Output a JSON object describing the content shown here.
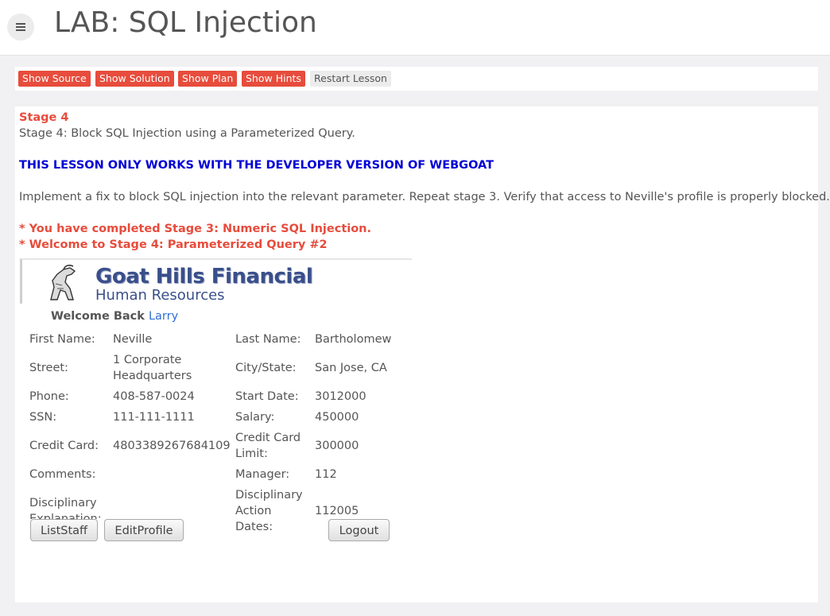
{
  "header": {
    "title": "LAB: SQL Injection",
    "menu_icon": "hamburger-menu-icon"
  },
  "toolbar": {
    "buttons": [
      "Show Source",
      "Show Solution",
      "Show Plan",
      "Show Hints",
      "Restart Lesson"
    ]
  },
  "lesson": {
    "stage_heading": "Stage 4",
    "stage_desc": "Stage 4: Block SQL Injection using a Parameterized Query.",
    "dev_notice": "THIS LESSON ONLY WORKS WITH THE DEVELOPER VERSION OF WEBGOAT",
    "instructions": "Implement a fix to block SQL injection into the relevant parameter. Repeat stage 3. Verify that access to Neville's profile is properly blocked.",
    "msg1": "* You have completed Stage 3: Numeric SQL Injection.",
    "msg2": "* Welcome to Stage 4: Parameterized Query #2"
  },
  "banner": {
    "brand_line1": "Goat Hills Financial",
    "brand_line2": "Human Resources"
  },
  "profile": {
    "welcome": "Welcome Back",
    "user": "Larry",
    "first_name_label": "First Name:",
    "first_name": "Neville",
    "last_name_label": "Last Name:",
    "last_name": "Bartholomew",
    "street_label": "Street:",
    "street_1": "1 Corporate",
    "street_2": "Headquarters",
    "city_label": "City/State:",
    "city": "San Jose, CA",
    "phone_label": "Phone:",
    "phone": "408-587-0024",
    "start_label": "Start Date:",
    "start": "3012000",
    "ssn_label": "SSN:",
    "ssn": "111-111-1111",
    "salary_label": "Salary:",
    "salary": "450000",
    "cc_label": "Credit Card:",
    "cc": "4803389267684109",
    "cc_limit_label_1": "Credit Card",
    "cc_limit_label_2": "Limit:",
    "cc_limit": "300000",
    "comments_label": "Comments:",
    "manager_label": "Manager:",
    "manager": "112",
    "disc_expl_label_1": "Disciplinary",
    "disc_expl_label_2": "Explanation:",
    "disc_dates_label_1": "Disciplinary",
    "disc_dates_label_2": "Action",
    "disc_dates_label_3": "Dates:",
    "disc_dates": "112005",
    "list_staff": "ListStaff",
    "edit_profile": "EditProfile",
    "logout": "Logout"
  }
}
